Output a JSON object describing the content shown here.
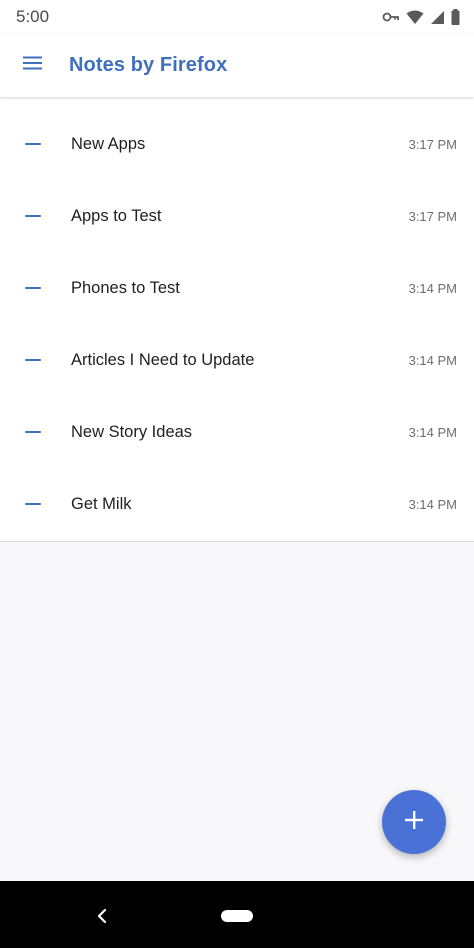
{
  "status_bar": {
    "time": "5:00",
    "icons": [
      "vpn-key-icon",
      "wifi-icon",
      "cell-signal-icon",
      "battery-icon"
    ]
  },
  "app_bar": {
    "title": "Notes by Firefox",
    "menu_icon": "hamburger-menu-icon",
    "accent_color": "#3f6fbf"
  },
  "notes": [
    {
      "title": "New Apps",
      "time": "3:17 PM"
    },
    {
      "title": "Apps to Test",
      "time": "3:17 PM"
    },
    {
      "title": "Phones to Test",
      "time": "3:14 PM"
    },
    {
      "title": "Articles I Need to Update",
      "time": "3:14 PM"
    },
    {
      "title": "New Story Ideas",
      "time": "3:14 PM"
    },
    {
      "title": "Get Milk",
      "time": "3:14 PM"
    }
  ],
  "fab": {
    "icon": "plus-icon",
    "color": "#4a72d6"
  },
  "nav_bar": {
    "icons": [
      "back-icon",
      "home-pill-icon"
    ]
  }
}
